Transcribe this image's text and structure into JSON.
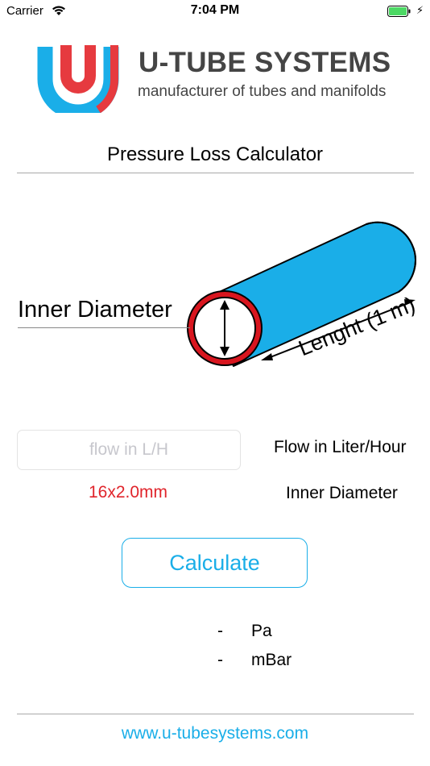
{
  "status_bar": {
    "carrier": "Carrier",
    "time": "7:04 PM",
    "battery_color": "#4cd964"
  },
  "brand": {
    "name": "U-TUBE SYSTEMS",
    "tagline": "manufacturer of tubes and manifolds",
    "blue": "#1aaee8",
    "red": "#e63a3f"
  },
  "page": {
    "title": "Pressure Loss Calculator"
  },
  "diagram": {
    "inner_diameter_label": "Inner Diameter",
    "length_label": "Lenght (1 m)",
    "pipe_color": "#1aaee8",
    "ring_color": "#d8161f"
  },
  "form": {
    "flow_placeholder": "flow in L/H",
    "flow_value": "",
    "flow_label": "Flow in Liter/Hour",
    "tube_size": "16x2.0mm",
    "diameter_label": "Inner Diameter",
    "calculate_label": "Calculate"
  },
  "results": {
    "pa_value": "-",
    "pa_unit": "Pa",
    "mbar_value": "-",
    "mbar_unit": "mBar"
  },
  "footer": {
    "website": "www.u-tubesystems.com"
  }
}
